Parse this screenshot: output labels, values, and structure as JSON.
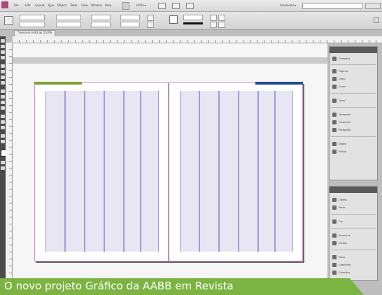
{
  "app": {
    "menu": [
      "File",
      "Edit",
      "Layout",
      "Type",
      "Object",
      "Table",
      "View",
      "Window",
      "Help"
    ],
    "zoom": "100% ▾",
    "workspace": "Advanced ▾"
  },
  "document_tab": "*novo-A.indd @ 110%",
  "right_panel_top": {
    "items": [
      "Camadas",
      "Páginas",
      "Links",
      "Cores",
      "Traço",
      "Tipografia",
      "Caractere",
      "Parágrafo",
      "Tabela",
      "Estilos"
    ]
  },
  "right_panel_bottom": {
    "items": [
      "Objeto",
      "Texto",
      "Cor",
      "Amostras",
      "Efeitos",
      "Traço",
      "Gradiente",
      "Camadas"
    ]
  },
  "caption": "O novo projeto Gráfico da AABB em Revista",
  "colors": {
    "caption_bg": "#7cb342",
    "accent_green": "#7fa32d",
    "accent_blue": "#214a98",
    "guide_violet": "#a399d9",
    "margin_magenta": "#d98ad8"
  }
}
